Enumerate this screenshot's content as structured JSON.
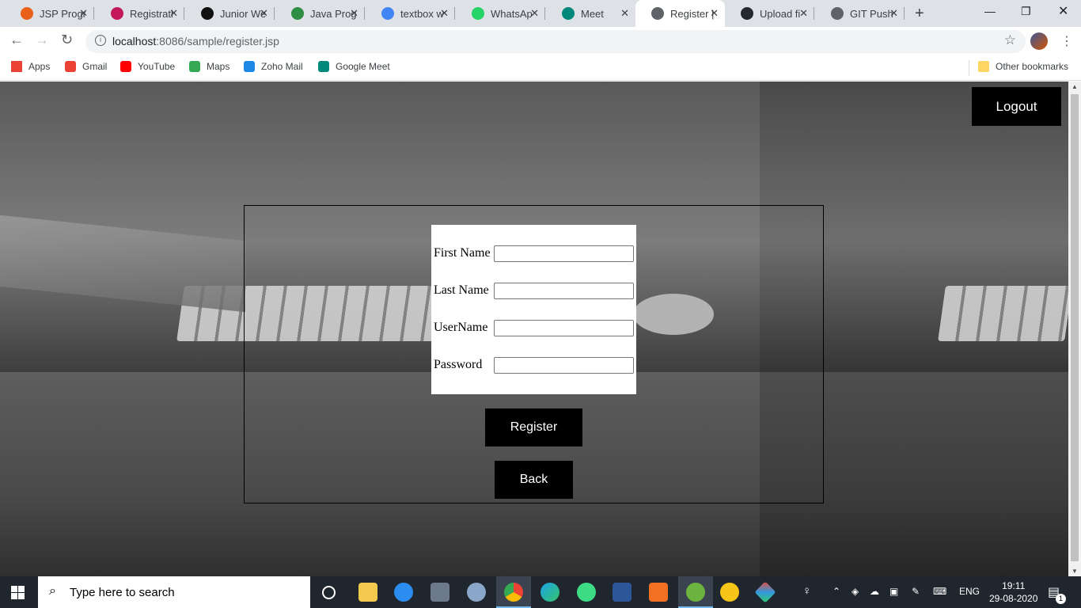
{
  "tabs": [
    {
      "title": "JSP Progr",
      "color": "#e8601a"
    },
    {
      "title": "Registrati",
      "color": "#c2185b"
    },
    {
      "title": "Junior We",
      "color": "#111111"
    },
    {
      "title": "Java Prog",
      "color": "#2f8d46"
    },
    {
      "title": "textbox w",
      "color": "#4285f4"
    },
    {
      "title": "WhatsAp",
      "color": "#25d366"
    },
    {
      "title": "Meet",
      "color": "#00897b"
    },
    {
      "title": "Register |",
      "color": "#5f6368"
    },
    {
      "title": "Upload fi",
      "color": "#24292e"
    },
    {
      "title": "GIT Push",
      "color": "#5f6368"
    }
  ],
  "address": {
    "host": "localhost",
    "path": ":8086/sample/register.jsp"
  },
  "bookmarks": [
    {
      "label": "Apps",
      "icon": "apps-grid-icon",
      "color": "#ea4335"
    },
    {
      "label": "Gmail",
      "icon": "gmail-icon",
      "color": "#ea4335"
    },
    {
      "label": "YouTube",
      "icon": "youtube-icon",
      "color": "#ff0000"
    },
    {
      "label": "Maps",
      "icon": "maps-icon",
      "color": "#34a853"
    },
    {
      "label": "Zoho Mail",
      "icon": "zoho-mail-icon",
      "color": "#1e88e5"
    },
    {
      "label": "Google Meet",
      "icon": "google-meet-icon",
      "color": "#00897b"
    }
  ],
  "other_bookmarks": "Other bookmarks",
  "page": {
    "logout": "Logout",
    "fields": [
      {
        "label": "First Name"
      },
      {
        "label": "Last Name"
      },
      {
        "label": "UserName"
      },
      {
        "label": "Password"
      }
    ],
    "register": "Register",
    "back": "Back"
  },
  "taskbar": {
    "search_placeholder": "Type here to search",
    "language": "ENG",
    "time": "19:11",
    "date": "29-08-2020",
    "notification_count": "1"
  }
}
